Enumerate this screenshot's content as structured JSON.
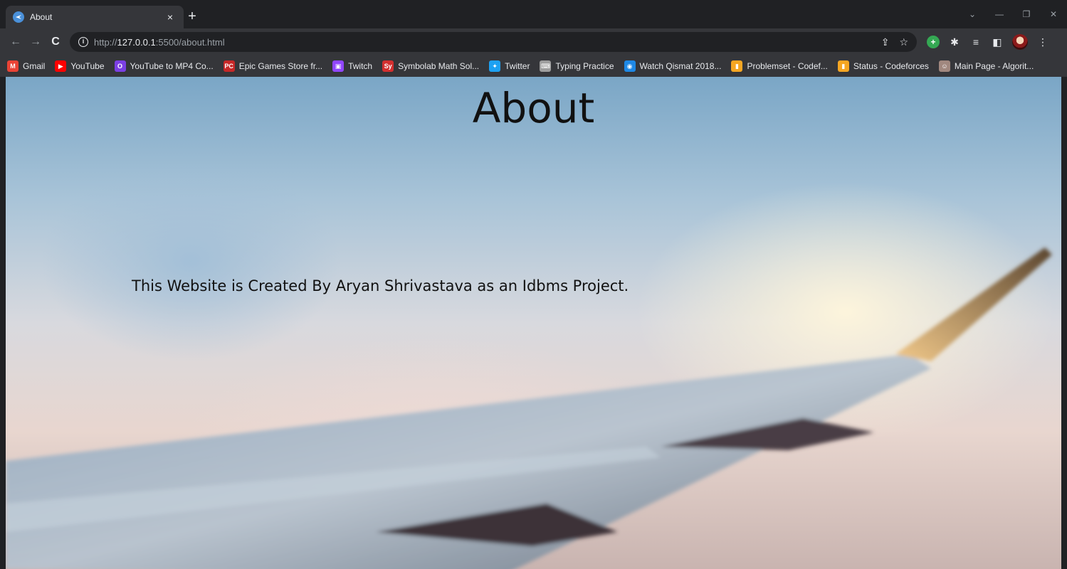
{
  "browser": {
    "tab_title": "About",
    "tab_close": "×",
    "new_tab": "+",
    "url_scheme": "http://",
    "url_host": "127.0.0.1",
    "url_rest": ":5500/about.html"
  },
  "bookmarks": [
    {
      "label": "Gmail",
      "icon": "gmail-icon",
      "color": "#ea4335",
      "glyph": "M"
    },
    {
      "label": "YouTube",
      "icon": "youtube-icon",
      "color": "#ff0000",
      "glyph": "▶"
    },
    {
      "label": "YouTube to MP4 Co...",
      "icon": "converter-icon",
      "color": "#7b3fe4",
      "glyph": "O"
    },
    {
      "label": "Epic Games Store fr...",
      "icon": "pc-gamer-icon",
      "color": "#c62828",
      "glyph": "PC"
    },
    {
      "label": "Twitch",
      "icon": "twitch-icon",
      "color": "#9146ff",
      "glyph": "▣"
    },
    {
      "label": "Symbolab Math Sol...",
      "icon": "symbolab-icon",
      "color": "#d32f2f",
      "glyph": "Sy"
    },
    {
      "label": "Twitter",
      "icon": "twitter-icon",
      "color": "#1da1f2",
      "glyph": "✦"
    },
    {
      "label": "Typing Practice",
      "icon": "keyboard-icon",
      "color": "#9e9e9e",
      "glyph": "⌨"
    },
    {
      "label": "Watch Qismat 2018...",
      "icon": "watch-icon",
      "color": "#1e88e5",
      "glyph": "◉"
    },
    {
      "label": "Problemset - Codef...",
      "icon": "codeforces-icon",
      "color": "#f5a623",
      "glyph": "▮"
    },
    {
      "label": "Status - Codeforces",
      "icon": "codeforces-icon",
      "color": "#f5a623",
      "glyph": "▮"
    },
    {
      "label": "Main Page - Algorit...",
      "icon": "algorithmica-icon",
      "color": "#a1887f",
      "glyph": "☺"
    }
  ],
  "page": {
    "title": "About",
    "text": "This Website is Created By Aryan Shrivastava as an Idbms Project."
  },
  "colors": {
    "chrome_dark": "#202124",
    "chrome": "#35363a",
    "text": "#111111"
  }
}
